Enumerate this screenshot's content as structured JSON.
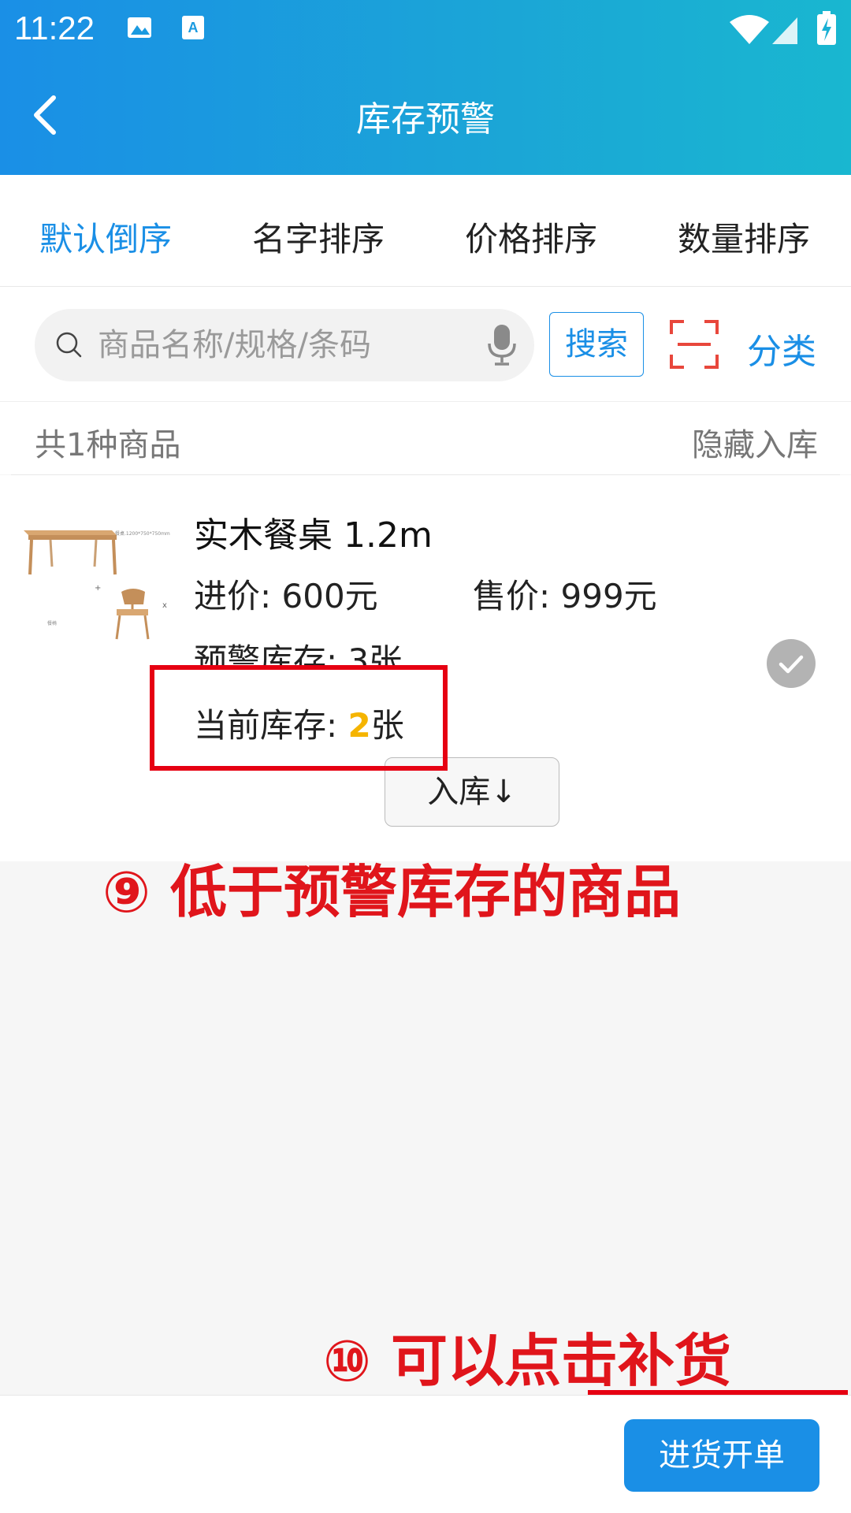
{
  "status": {
    "time": "11:22"
  },
  "header": {
    "title": "库存预警"
  },
  "sort_tabs": [
    {
      "label": "默认倒序",
      "active": true
    },
    {
      "label": "名字排序",
      "active": false
    },
    {
      "label": "价格排序",
      "active": false
    },
    {
      "label": "数量排序",
      "active": false
    }
  ],
  "search": {
    "placeholder": "商品名称/规格/条码",
    "button_label": "搜索",
    "category_label": "分类"
  },
  "list": {
    "count_text": "共1种商品",
    "hide_label": "隐藏入库"
  },
  "product": {
    "name": "实木餐桌  1.2m",
    "purchase_price": "进价: 600元",
    "sale_price": "售价: 999元",
    "warning_stock": "预警库存: 3张",
    "current_stock_label": "当前库存: ",
    "current_stock_value": "2",
    "current_stock_unit": "张",
    "stock_in_label": "入库↓",
    "image_caption": "餐桌.1200*750*750mm"
  },
  "annotations": {
    "note9": "⑨ 低于预警库存的商品",
    "note10": "⑩ 可以点击补货"
  },
  "bottom": {
    "purchase_label": "进货开单"
  },
  "colors": {
    "accent": "#1a8fe6",
    "annotation": "#e0151b",
    "stock_highlight": "#f5b400"
  }
}
